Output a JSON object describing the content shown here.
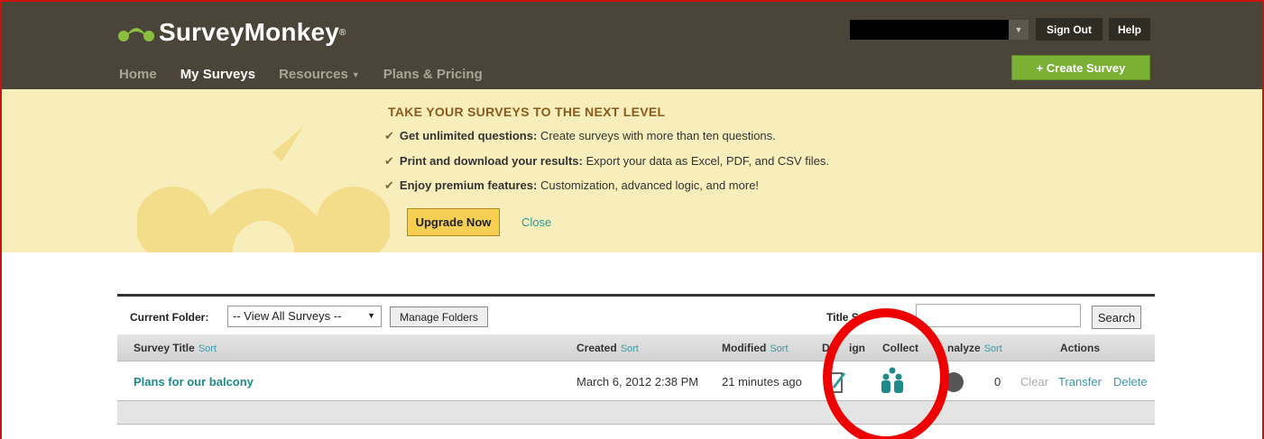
{
  "brand": {
    "name": "SurveyMonkey",
    "reg": "®"
  },
  "nav": {
    "home": "Home",
    "my_surveys": "My Surveys",
    "resources": "Resources",
    "plans": "Plans & Pricing"
  },
  "header": {
    "sign_out": "Sign Out",
    "help": "Help",
    "create_survey": "+ Create Survey"
  },
  "promo": {
    "title": "TAKE YOUR SURVEYS TO THE NEXT LEVEL",
    "bullets": [
      {
        "bold": "Get unlimited questions:",
        "text": " Create surveys with more than ten questions."
      },
      {
        "bold": "Print and download your results:",
        "text": " Export your data as Excel, PDF, and CSV files."
      },
      {
        "bold": "Enjoy premium features:",
        "text": " Customization, advanced logic, and more!"
      }
    ],
    "upgrade": "Upgrade Now",
    "close": "Close"
  },
  "toolbar": {
    "current_folder": "Current Folder:",
    "folder_value": "-- View All Surveys --",
    "manage_folders": "Manage Folders",
    "title_search_visible": "Title Se",
    "search": "Search"
  },
  "columns": {
    "survey_title": "Survey Title",
    "created": "Created",
    "modified": "Modified",
    "design_a": "De",
    "design_b": "ign",
    "collect": "Collect",
    "analyze_visible": "nalyze",
    "actions": "Actions",
    "sort": "Sort"
  },
  "row": {
    "title": "Plans for our balcony",
    "created": "March 6, 2012 2:38 PM",
    "modified": "21 minutes ago",
    "responses": "0",
    "clear": "Clear",
    "transfer": "Transfer",
    "delete": "Delete"
  },
  "colors": {
    "header_bg": "#4a4538",
    "promo_bg": "#f8eebb",
    "accent_green": "#7ab033",
    "link_teal": "#1f8a8a",
    "annotation_red": "#ee0000"
  }
}
